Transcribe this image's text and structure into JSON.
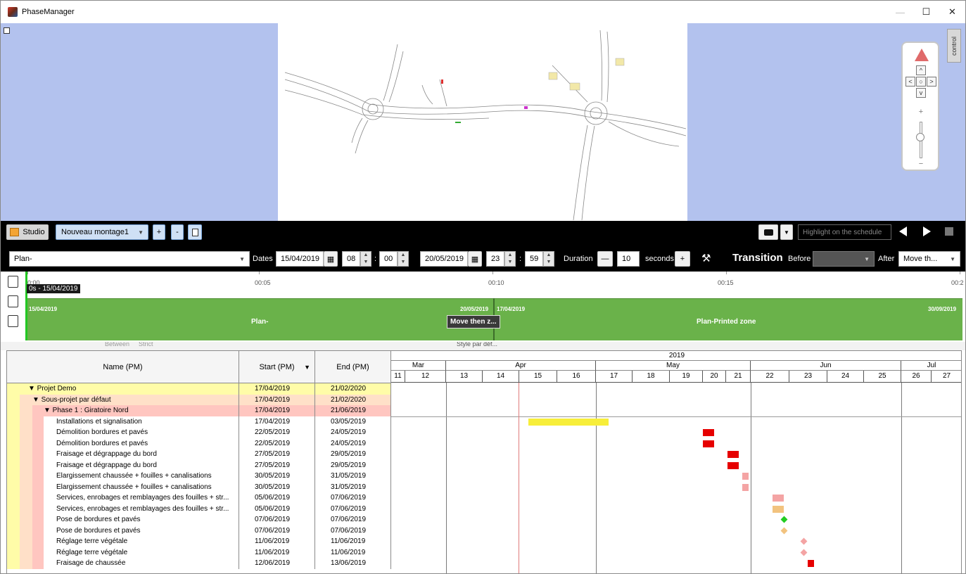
{
  "window": {
    "title": "PhaseManager",
    "minimize": "—",
    "maximize": "☐",
    "close": "✕"
  },
  "viewport": {
    "control_tab": "control"
  },
  "toolbar": {
    "studio_label": "Studio",
    "montage_select": "Nouveau montage1",
    "add_label": "+",
    "remove_label": "-",
    "highlight_placeholder": "Highlight on the schedule",
    "plan_select": "Plan-",
    "dates_label": "Dates",
    "start_date": "15/04/2019",
    "start_hour": "08",
    "start_minute": "00",
    "end_date": "20/05/2019",
    "end_hour": "23",
    "end_minute": "59",
    "duration_label": "Duration",
    "duration_value": "10",
    "seconds_label": "seconds",
    "transition_label": "Transition",
    "before_label": "Before",
    "after_label": "After",
    "after_select": "Move th...",
    "colon": ":",
    "minus": "—",
    "plus": "+"
  },
  "timeline": {
    "ticks": [
      "0:00",
      "00:05",
      "00:10",
      "00:15",
      "00:2"
    ],
    "cursor_label": "0s - 15/04/2019",
    "segment1_start": "15/04/2019",
    "segment1_label": "Plan-",
    "segment1_end": "20/05/2019",
    "segment2_start": "17/04/2019",
    "segment2_label": "Plan-Printed zone",
    "segment2_end": "30/09/2019",
    "transition_tag": "Move then z..."
  },
  "strip": {
    "between": "Between",
    "strict": "Strict",
    "style": "Style par déf..."
  },
  "gantt": {
    "headers": {
      "name": "Name (PM)",
      "start": "Start (PM)",
      "end": "End (PM)",
      "sort_icon": "▼"
    },
    "year": "2019",
    "months": [
      "Mar",
      "Apr",
      "May",
      "Jun",
      "Jul"
    ],
    "weeks": [
      "11",
      "12",
      "13",
      "14",
      "15",
      "16",
      "17",
      "18",
      "19",
      "20",
      "21",
      "22",
      "23",
      "24",
      "25",
      "26",
      "27"
    ],
    "rows": [
      {
        "name": "▼ Projet Demo",
        "start": "17/04/2019",
        "end": "21/02/2020"
      },
      {
        "name": "▼ Sous-projet par défaut",
        "start": "17/04/2019",
        "end": "21/02/2020"
      },
      {
        "name": "▼ Phase 1 : Giratoire Nord",
        "start": "17/04/2019",
        "end": "21/06/2019"
      },
      {
        "name": "Installations et signalisation",
        "start": "17/04/2019",
        "end": "03/05/2019"
      },
      {
        "name": "Démolition bordures et pavés",
        "start": "22/05/2019",
        "end": "24/05/2019"
      },
      {
        "name": "Démolition bordures et pavés",
        "start": "22/05/2019",
        "end": "24/05/2019"
      },
      {
        "name": "Fraisage et dégrappage du bord",
        "start": "27/05/2019",
        "end": "29/05/2019"
      },
      {
        "name": "Fraisage et dégrappage du bord",
        "start": "27/05/2019",
        "end": "29/05/2019"
      },
      {
        "name": "Elargissement chaussée + fouilles + canalisations",
        "start": "30/05/2019",
        "end": "31/05/2019"
      },
      {
        "name": "Elargissement chaussée + fouilles + canalisations",
        "start": "30/05/2019",
        "end": "31/05/2019"
      },
      {
        "name": "Services, enrobages et remblayages des fouilles + str...",
        "start": "05/06/2019",
        "end": "07/06/2019"
      },
      {
        "name": "Services, enrobages et remblayages des fouilles + str...",
        "start": "05/06/2019",
        "end": "07/06/2019"
      },
      {
        "name": "Pose de bordures et pavés",
        "start": "07/06/2019",
        "end": "07/06/2019"
      },
      {
        "name": "Pose de bordures et pavés",
        "start": "07/06/2019",
        "end": "07/06/2019"
      },
      {
        "name": "Réglage terre végétale",
        "start": "11/06/2019",
        "end": "11/06/2019"
      },
      {
        "name": "Réglage terre végétale",
        "start": "11/06/2019",
        "end": "11/06/2019"
      },
      {
        "name": "Fraisage de chaussée",
        "start": "12/06/2019",
        "end": "13/06/2019"
      }
    ]
  },
  "colors": {
    "viewport_bg": "#b3c2ee",
    "timeline_green": "#6ab24a",
    "row_project": "#fffca8",
    "row_subproject": "#ffe0c8",
    "row_phase": "#ffc6c0",
    "bar_yellow": "#f7ee3a",
    "bar_red": "#e60000",
    "bar_pink": "#f4a4a4",
    "bar_orange": "#f2c37f",
    "milestone_green": "#22cc22"
  }
}
